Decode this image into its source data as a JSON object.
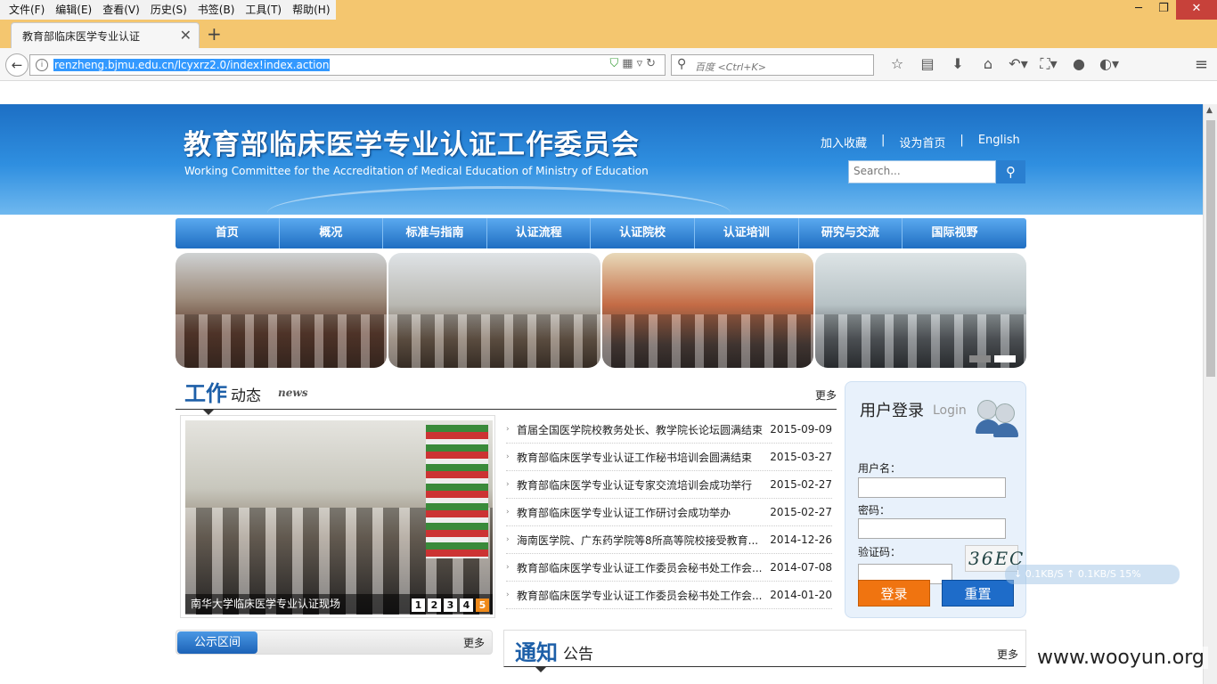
{
  "menu": [
    "文件(F)",
    "编辑(E)",
    "查看(V)",
    "历史(S)",
    "书签(B)",
    "工具(T)",
    "帮助(H)"
  ],
  "window": {
    "minimize": "─",
    "maximize": "❐",
    "close": "✕"
  },
  "tab": {
    "title": "教育部临床医学专业认证",
    "close": "✕",
    "new": "+"
  },
  "address": {
    "url": "renzheng.bjmu.edu.cn/lcyxrz2.0/index!index.action"
  },
  "search": {
    "placeholder": "百度 <Ctrl+K>"
  },
  "site": {
    "title": "教育部临床医学专业认证工作委员会",
    "subtitle": "Working Committee for the Accreditation of Medical Education of Ministry of Education",
    "top_links": [
      "加入收藏",
      "|",
      "设为首页",
      "|",
      "English"
    ],
    "search_placeholder": "Search..."
  },
  "nav": [
    "首页",
    "概况",
    "标准与指南",
    "认证流程",
    "认证院校",
    "认证培训",
    "研究与交流",
    "国际视野"
  ],
  "news": {
    "title_big": "工作",
    "title_small": "动态",
    "title_en": "news",
    "more": "更多",
    "photo_caption": "南华大学临床医学专业认证现场",
    "pager": [
      "1",
      "2",
      "3",
      "4",
      "5"
    ],
    "pager_active": 4,
    "items": [
      {
        "title": "首届全国医学院校教务处长、教学院长论坛圆满结束",
        "date": "2015-09-09"
      },
      {
        "title": "教育部临床医学专业认证工作秘书培训会圆满结束",
        "date": "2015-03-27"
      },
      {
        "title": "教育部临床医学专业认证专家交流培训会成功举行",
        "date": "2015-02-27"
      },
      {
        "title": "教育部临床医学专业认证工作研讨会成功举办",
        "date": "2015-02-27"
      },
      {
        "title": "海南医学院、广东药学院等8所高等院校接受教育...",
        "date": "2014-12-26"
      },
      {
        "title": "教育部临床医学专业认证工作委员会秘书处工作会...",
        "date": "2014-07-08"
      },
      {
        "title": "教育部临床医学专业认证工作委员会秘书处工作会...",
        "date": "2014-01-20"
      }
    ]
  },
  "login": {
    "title": "用户登录",
    "title_en": "Login",
    "username_label": "用户名：",
    "password_label": "密码：",
    "captcha_label": "验证码：",
    "captcha_text": "36EC",
    "login_button": "登录",
    "reset_button": "重置"
  },
  "netmon": "↓ 0.1KB/S   ↑ 0.1KB/S   15%",
  "public": {
    "tab": "公示区间",
    "more": "更多"
  },
  "notice": {
    "title_big": "通知",
    "title_small": "公告",
    "more": "更多"
  },
  "watermark": "www.wooyun.org",
  "colors": {
    "banner": "#1d6fc4",
    "nav": "#1f6ec2",
    "login_btn": "#f07410",
    "reset_btn": "#1e6cc9",
    "titlebar": "#f4c66f"
  }
}
